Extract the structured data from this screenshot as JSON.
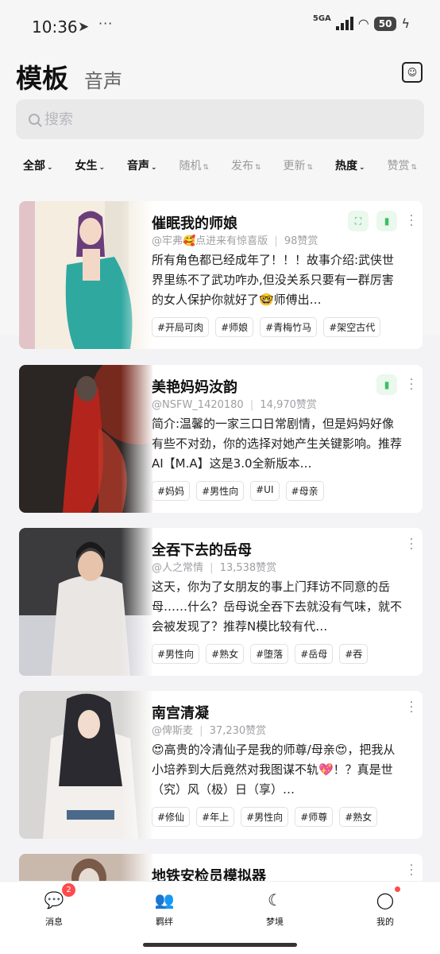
{
  "status_bar": {
    "time": "10:36",
    "icons": [
      "send-icon",
      "dots-icon"
    ],
    "network_label": "5GA",
    "battery": "50"
  },
  "header": {
    "title": "模板",
    "subtitle_tab": "音声",
    "icon": "template-box-icon"
  },
  "search": {
    "placeholder": "搜索"
  },
  "filters": [
    {
      "label": "全部",
      "active": true
    },
    {
      "label": "女生",
      "active": true
    },
    {
      "label": "音声",
      "active": true
    },
    {
      "label": "随机",
      "active": false
    },
    {
      "label": "发布",
      "active": false
    },
    {
      "label": "更新",
      "active": false
    },
    {
      "label": "热度",
      "active": true
    },
    {
      "label": "赞赏",
      "active": false
    }
  ],
  "cards": [
    {
      "title": "催眠我的师娘",
      "author": "@牢弗🥰点进来有惊喜版",
      "likes": "98赞赏",
      "description": "所有角色都已经成年了！！！故事介绍:武侠世界里练不了武功咋办,但没关系只要有一群厉害的女人保护你就好了🤓师傅出…",
      "tags": [
        "#开局可肉",
        "#师娘",
        "#青梅竹马",
        "#架空古代"
      ],
      "actions": [
        "expand-icon",
        "voice-icon"
      ],
      "thumb_colors": [
        "#f4ede0",
        "#2fa8a0",
        "#6a3e7a"
      ]
    },
    {
      "title": "美艳妈妈汝韵",
      "author": "@NSFW_1420180",
      "likes": "14,970赞赏",
      "description": "简介:温馨的一家三口日常剧情，但是妈妈好像有些不对劲，你的选择对她产生关键影响。推荐AI【M.A】这是3.0全新版本…",
      "tags": [
        "#妈妈",
        "#男性向",
        "#UI",
        "#母亲"
      ],
      "actions": [
        "voice-icon"
      ],
      "thumb_colors": [
        "#2b2523",
        "#b3241d",
        "#5a4a44"
      ]
    },
    {
      "title": "全吞下去的岳母",
      "author": "@人之常情",
      "likes": "13,538赞赏",
      "description": "这天，你为了女朋友的事上门拜访不同意的岳母……什么？岳母说全吞下去就没有气味，就不会被发现了？推荐N模比较有代…",
      "tags": [
        "#男性向",
        "#熟女",
        "#堕落",
        "#岳母",
        "#吞"
      ],
      "actions": [],
      "thumb_colors": [
        "#3b3a3c",
        "#e9e6e4",
        "#1a1a1a"
      ]
    },
    {
      "title": "南宫清凝",
      "author": "@俾斯麦",
      "likes": "37,230赞赏",
      "description": "😍高贵的冷清仙子是我的师尊/母亲😍，把我从小培养到大后竟然对我图谋不轨💖！？真是世（究）风（极）日（享）…",
      "tags": [
        "#修仙",
        "#年上",
        "#男性向",
        "#师尊",
        "#熟女"
      ],
      "actions": [],
      "thumb_colors": [
        "#d8d6d4",
        "#f2efec",
        "#2a2a30"
      ]
    },
    {
      "title": "地铁安检员模拟器",
      "author": "",
      "likes": "",
      "description": "",
      "tags": [],
      "actions": [],
      "thumb_colors": [
        "#c9b9ad",
        "#7a5a48",
        "#e6dcd4"
      ]
    }
  ],
  "tabbar": [
    {
      "label": "消息",
      "icon": "message-icon",
      "badge": "2"
    },
    {
      "label": "羁绊",
      "icon": "users-icon",
      "badge": ""
    },
    {
      "label": "梦境",
      "icon": "moon-icon",
      "badge": ""
    },
    {
      "label": "我的",
      "icon": "profile-icon",
      "badge": "dot"
    }
  ]
}
